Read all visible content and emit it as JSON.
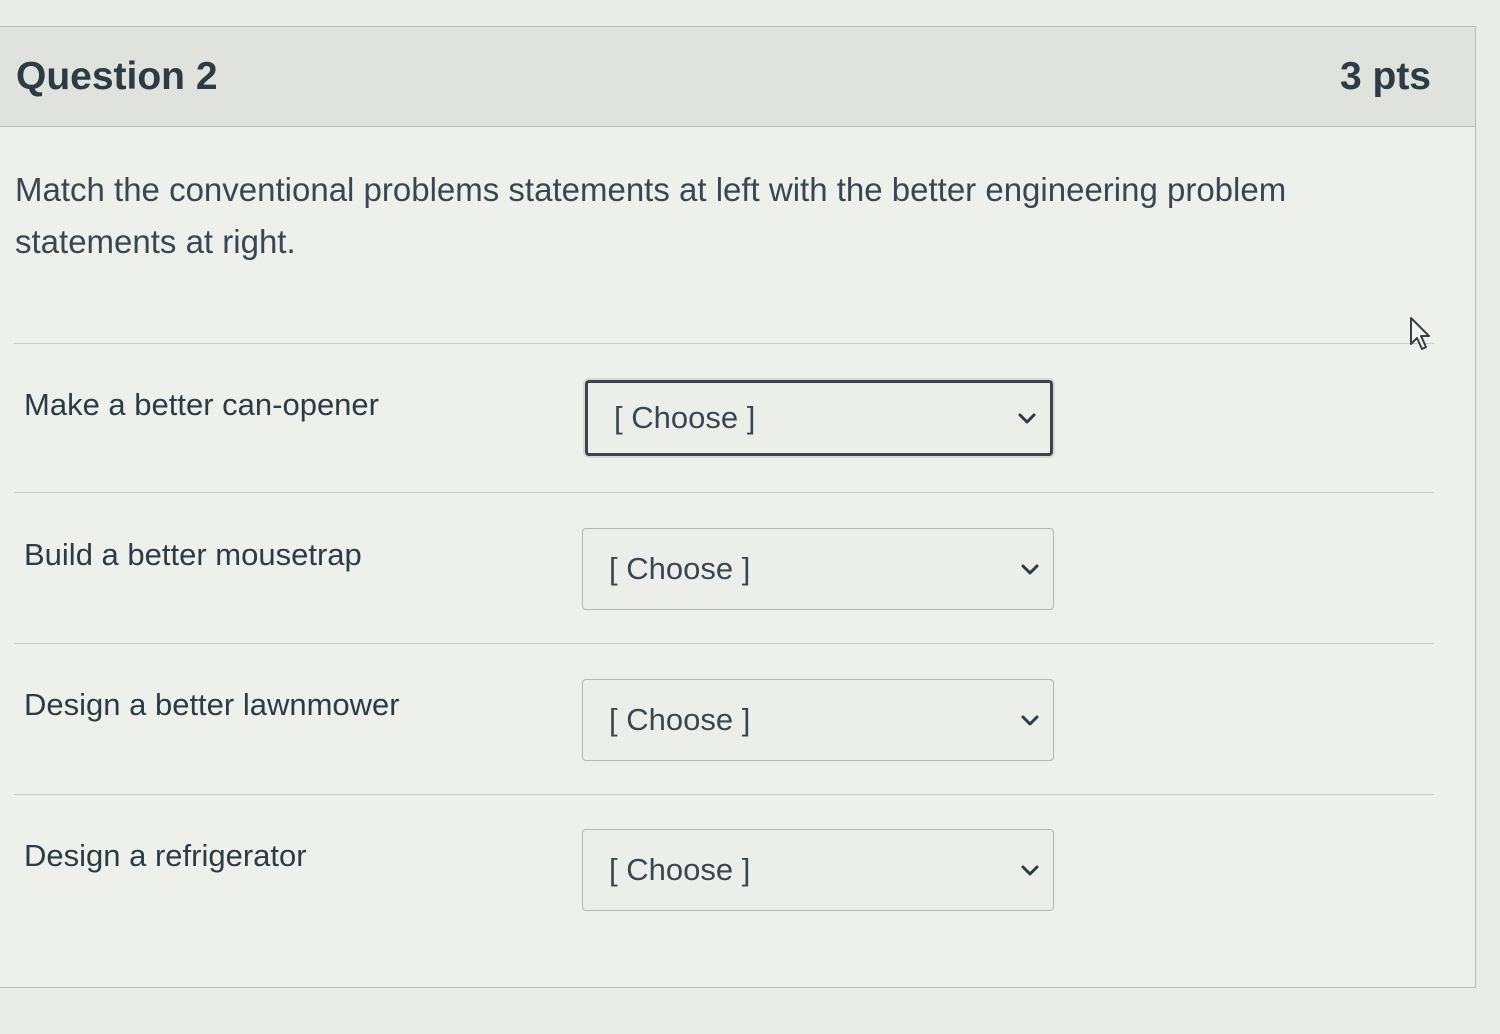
{
  "question": {
    "title": "Question 2",
    "points": "3 pts",
    "prompt": "Match the conventional problems statements at left with the better engineering problem statements at right."
  },
  "matches": [
    {
      "label": "Make a better can-opener",
      "selected": "[ Choose ]",
      "focused": true
    },
    {
      "label": "Build a better mousetrap",
      "selected": "[ Choose ]",
      "focused": false
    },
    {
      "label": "Design a better lawnmower",
      "selected": "[ Choose ]",
      "focused": false
    },
    {
      "label": "Design a refrigerator",
      "selected": "[ Choose ]",
      "focused": false
    }
  ],
  "icons": {
    "dropdown": "chevron-down-icon",
    "cursor": "mouse-pointer-icon"
  },
  "colors": {
    "text": "#2d3b45",
    "header_bg": "#e0e2de",
    "focus_border": "#3f4448"
  }
}
